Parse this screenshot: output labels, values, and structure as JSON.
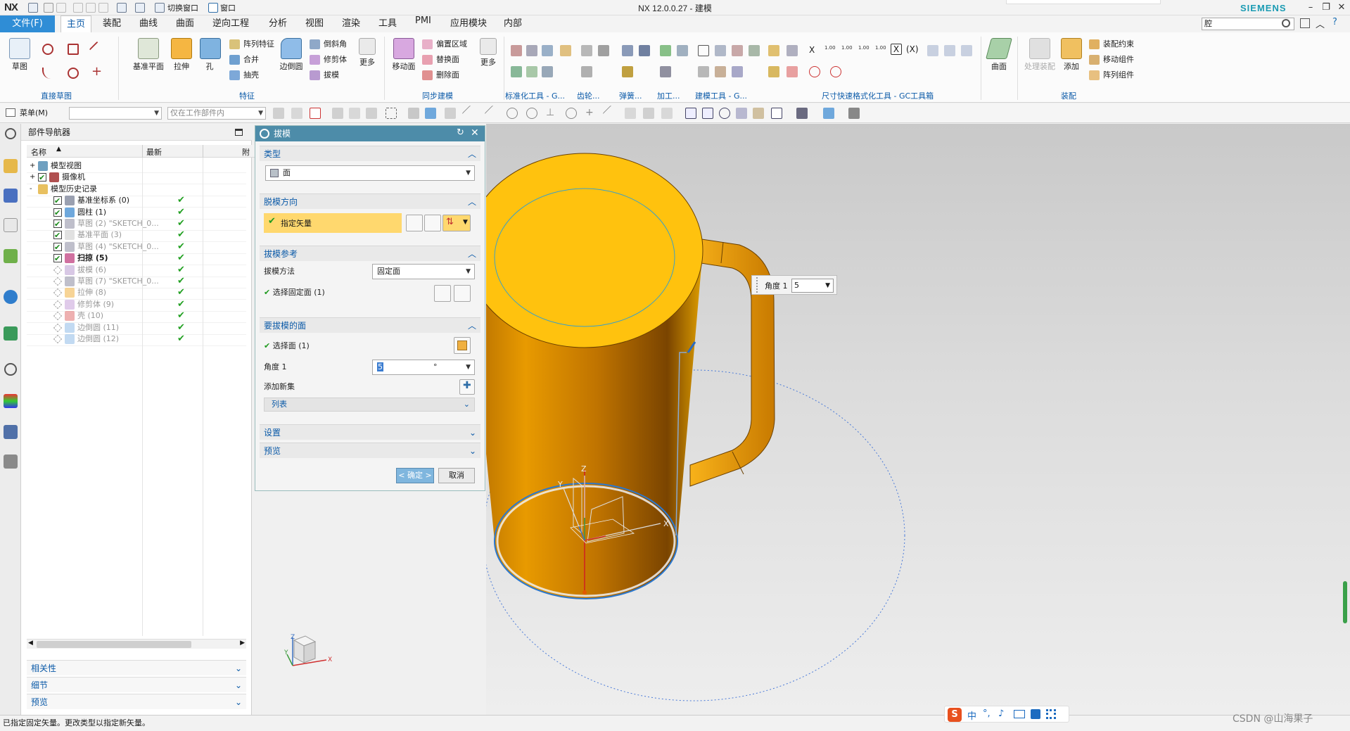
{
  "window": {
    "title": "NX 12.0.0.27 - 建模",
    "logo": "NX",
    "brand": "SIEMENS",
    "quick_access": {
      "switch_window": "切换窗口",
      "window_menu": "窗口"
    },
    "controls": [
      "minimize",
      "restore",
      "close"
    ]
  },
  "menu": {
    "file": "文件(F)",
    "tabs": [
      "主页",
      "装配",
      "曲线",
      "曲面",
      "逆向工程",
      "分析",
      "视图",
      "渲染",
      "工具",
      "PMI",
      "应用模块",
      "内部"
    ],
    "active_tab": "主页",
    "search_value": "腔"
  },
  "ribbon": {
    "groups": [
      {
        "label": "直接草图",
        "buttons": [
          "草图"
        ]
      },
      {
        "label": "特征",
        "buttons": [
          "基准平面",
          "拉伸",
          "孔",
          "阵列特征",
          "合并",
          "抽壳",
          "边倒圆",
          "倒斜角",
          "修剪体",
          "拔模",
          "更多"
        ]
      },
      {
        "label": "同步建模",
        "buttons": [
          "移动面",
          "偏置区域",
          "替换面",
          "删除面",
          "更多"
        ]
      },
      {
        "label": "标准化工具 - G...",
        "buttons": []
      },
      {
        "label": "齿轮...",
        "buttons": []
      },
      {
        "label": "弹簧...",
        "buttons": []
      },
      {
        "label": "加工...",
        "buttons": []
      },
      {
        "label": "建模工具 - G...",
        "buttons": []
      },
      {
        "label": "尺寸快速格式化工具 - GC工具箱",
        "buttons": [
          "X",
          "(X)"
        ]
      },
      {
        "label": "",
        "buttons": [
          "曲面"
        ]
      },
      {
        "label": "装配",
        "buttons": [
          "处理装配",
          "添加",
          "装配约束",
          "移动组件",
          "阵列组件"
        ]
      }
    ]
  },
  "selection_bar": {
    "menu": "菜单(M)",
    "filter_value": "",
    "scope_placeholder": "仅在工作部件内"
  },
  "navigator": {
    "title": "部件导航器",
    "columns": [
      "名称",
      "最新",
      "附"
    ],
    "rows": [
      {
        "name": "模型视图",
        "level": 0,
        "expand": "+",
        "checked": null,
        "dim": false,
        "bold": false,
        "latest": false,
        "icon": "model-views"
      },
      {
        "name": "摄像机",
        "level": 0,
        "expand": "+",
        "checked": true,
        "dim": false,
        "bold": false,
        "latest": false,
        "icon": "camera"
      },
      {
        "name": "模型历史记录",
        "level": 0,
        "expand": "-",
        "checked": null,
        "dim": false,
        "bold": false,
        "latest": false,
        "icon": "folder"
      },
      {
        "name": "基准坐标系 (0)",
        "level": 1,
        "expand": "",
        "checked": true,
        "dim": false,
        "bold": false,
        "latest": true,
        "icon": "datum-csys"
      },
      {
        "name": "圆柱 (1)",
        "level": 1,
        "expand": "",
        "checked": true,
        "dim": false,
        "bold": false,
        "latest": true,
        "icon": "cylinder"
      },
      {
        "name": "草图 (2) \"SKETCH_0...",
        "level": 1,
        "expand": "",
        "checked": true,
        "dim": true,
        "bold": false,
        "latest": true,
        "icon": "sketch"
      },
      {
        "name": "基准平面 (3)",
        "level": 1,
        "expand": "",
        "checked": true,
        "dim": true,
        "bold": false,
        "latest": true,
        "icon": "datum-plane"
      },
      {
        "name": "草图 (4) \"SKETCH_0...",
        "level": 1,
        "expand": "",
        "checked": true,
        "dim": true,
        "bold": false,
        "latest": true,
        "icon": "sketch"
      },
      {
        "name": "扫掠 (5)",
        "level": 1,
        "expand": "",
        "checked": true,
        "dim": false,
        "bold": true,
        "latest": true,
        "icon": "sweep"
      },
      {
        "name": "拔模 (6)",
        "level": 1,
        "expand": "",
        "checked": false,
        "dim": true,
        "bold": false,
        "latest": true,
        "icon": "draft"
      },
      {
        "name": "草图 (7) \"SKETCH_0...",
        "level": 1,
        "expand": "",
        "checked": false,
        "dim": true,
        "bold": false,
        "latest": true,
        "icon": "sketch"
      },
      {
        "name": "拉伸 (8)",
        "level": 1,
        "expand": "",
        "checked": false,
        "dim": true,
        "bold": false,
        "latest": true,
        "icon": "extrude"
      },
      {
        "name": "修剪体 (9)",
        "level": 1,
        "expand": "",
        "checked": false,
        "dim": true,
        "bold": false,
        "latest": true,
        "icon": "trim-body"
      },
      {
        "name": "壳 (10)",
        "level": 1,
        "expand": "",
        "checked": false,
        "dim": true,
        "bold": false,
        "latest": true,
        "icon": "shell"
      },
      {
        "name": "边倒圆 (11)",
        "level": 1,
        "expand": "",
        "checked": false,
        "dim": true,
        "bold": false,
        "latest": true,
        "icon": "edge-blend"
      },
      {
        "name": "边倒圆 (12)",
        "level": 1,
        "expand": "",
        "checked": false,
        "dim": true,
        "bold": false,
        "latest": true,
        "icon": "edge-blend"
      }
    ],
    "sections": [
      "相关性",
      "细节",
      "预览"
    ]
  },
  "dialog": {
    "title": "拔模",
    "type_section": "类型",
    "type_value": "面",
    "direction_section": "脱模方向",
    "specify_vector": "指定矢量",
    "reference_section": "拔模参考",
    "draft_method_label": "拔模方法",
    "draft_method_value": "固定面",
    "select_stationary": "选择固定面 (1)",
    "faces_section": "要拔模的面",
    "select_face": "选择面 (1)",
    "angle_label": "角度 1",
    "angle_value": "5",
    "angle_unit": "°",
    "add_new_set": "添加新集",
    "list_label": "列表",
    "settings_section": "设置",
    "preview_section": "预览",
    "ok": "< 确定 >",
    "cancel": "取消"
  },
  "viewport": {
    "angle_tip_label": "角度 1",
    "angle_tip_value": "5",
    "axis_labels": {
      "x": "X",
      "y": "Y",
      "z": "Z"
    },
    "triad_labels": {
      "x": "X",
      "y": "Y",
      "z": "Z"
    }
  },
  "status": {
    "message": "已指定固定矢量。更改类型以指定新矢量。"
  },
  "ime": {
    "lang": "中"
  },
  "watermark": "CSDN @山海果子",
  "colors": {
    "accent": "#2f8dd6",
    "dialog_title": "#4d8ca9",
    "mug_top": "#ffc20e",
    "mug_side": "#d98d00",
    "vector_highlight": "#ffd86e"
  }
}
